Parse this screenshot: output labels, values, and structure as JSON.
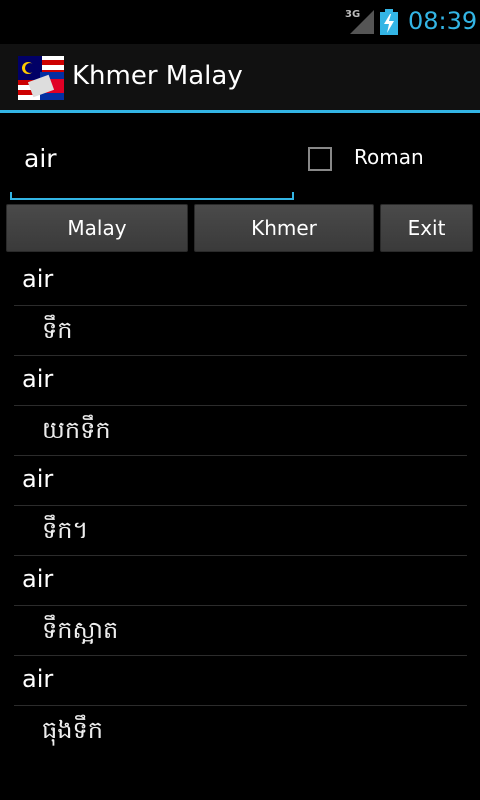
{
  "status_bar": {
    "network": "3G",
    "time": "08:39"
  },
  "app": {
    "title": "Khmer Malay"
  },
  "search": {
    "value": "air"
  },
  "options": {
    "roman_label": "Roman",
    "roman_checked": false
  },
  "buttons": {
    "malay": "Malay",
    "khmer": "Khmer",
    "exit": "Exit"
  },
  "results": [
    {
      "word": "air",
      "translation": "ទឹក"
    },
    {
      "word": "air",
      "translation": "យកទឹក"
    },
    {
      "word": "air",
      "translation": "ទឹក។"
    },
    {
      "word": "air",
      "translation": "ទឹកស្អាត"
    },
    {
      "word": "air",
      "translation": "ធុងទឹក"
    }
  ],
  "colors": {
    "accent": "#33b5e5",
    "background": "#000000"
  }
}
